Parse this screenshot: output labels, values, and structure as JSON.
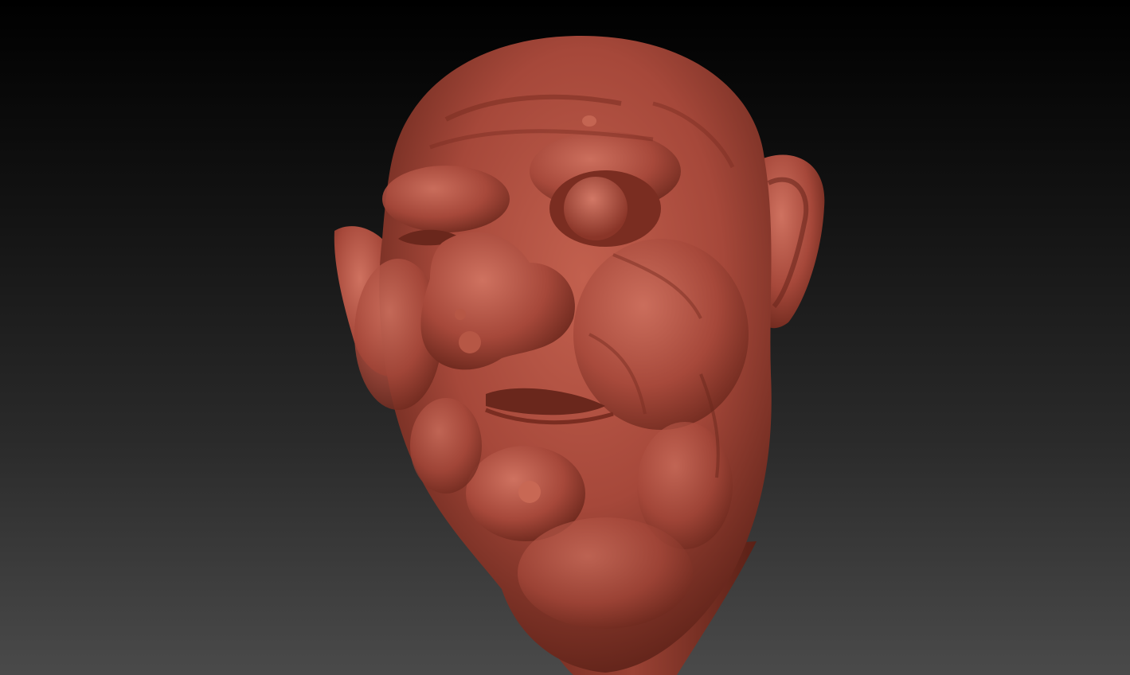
{
  "viewport": {
    "background_top": "#000000",
    "background_bottom": "#4a4a4a"
  },
  "sculpt": {
    "subject": "stylized-ogre-head",
    "material_color": "#a6483a",
    "shadow_color": "#5e2218",
    "highlight_color": "#c96a58"
  }
}
